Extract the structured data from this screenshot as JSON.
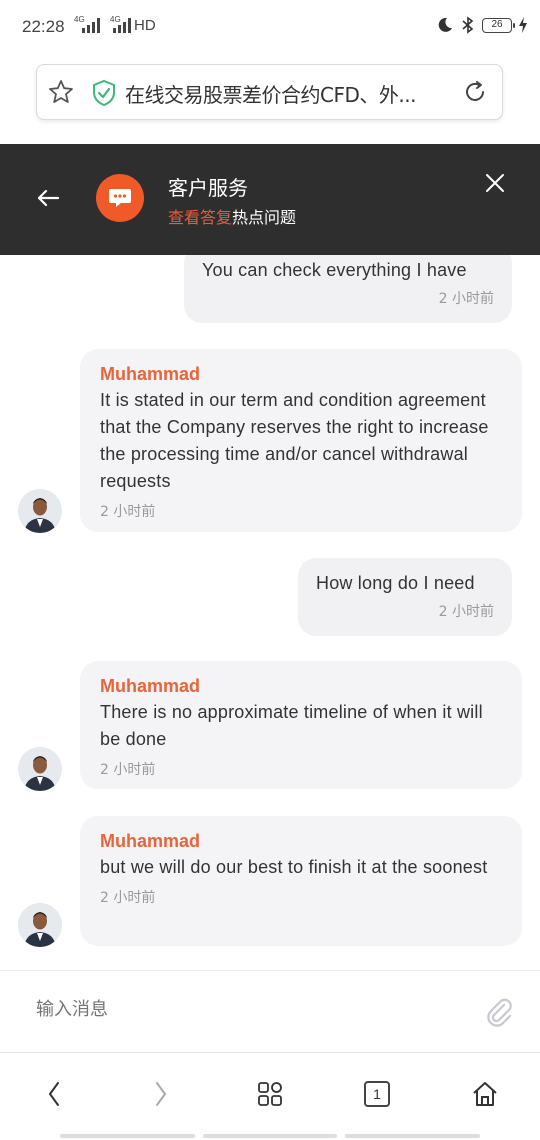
{
  "status_bar": {
    "time": "22:28",
    "network_1": "4G",
    "network_2": "4G",
    "hd": "HD",
    "battery": "26"
  },
  "url_bar": {
    "title": "在线交易股票差价合约CFD、外..."
  },
  "chat_header": {
    "title": "客户服务",
    "link_active": "查看答复",
    "link": "热点问题",
    "badge_color": "#f05a28",
    "background": "#2e2e2e"
  },
  "messages": [
    {
      "direction": "out",
      "text": "You can check everything I have",
      "time": "2 小时前"
    },
    {
      "direction": "in",
      "sender": "Muhammad",
      "text": "It is stated in our term and condition agreement that the Company reserves the right to increase the processing time and/or cancel withdrawal requests",
      "time": "2 小时前"
    },
    {
      "direction": "out",
      "text": "How long do I need",
      "time": "2 小时前"
    },
    {
      "direction": "in",
      "sender": "Muhammad",
      "text": "There is no approximate timeline of when it will be done",
      "time": "2 小时前"
    },
    {
      "direction": "in",
      "sender": "Muhammad",
      "text": "but we will do our best to finish it at the soonest",
      "time": "2 小时前"
    }
  ],
  "input": {
    "placeholder": "输入消息"
  },
  "bottom_nav": {
    "tab_count": "1"
  },
  "colors": {
    "accent": "#e8643a",
    "bubble_bg": "#f3f3f6"
  }
}
